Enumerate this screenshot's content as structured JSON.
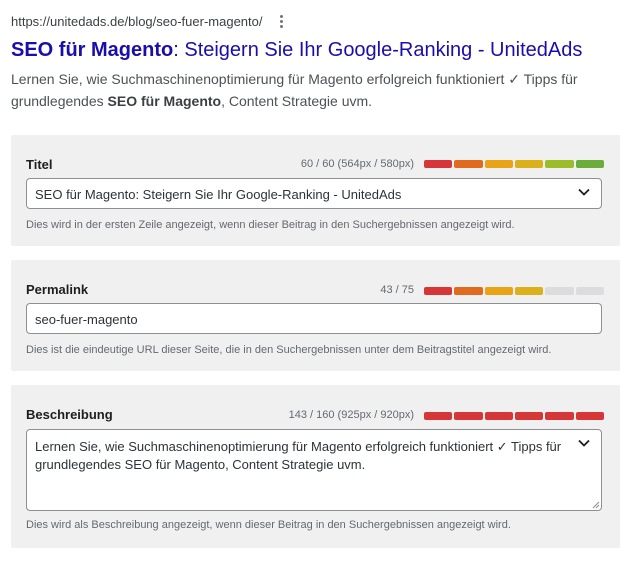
{
  "serp": {
    "url": "https://unitedads.de/blog/seo-fuer-magento/",
    "title_strong": "SEO für Magento",
    "title_rest": ": Steigern Sie Ihr Google-Ranking - UnitedAds",
    "desc_line1": "Lernen Sie, wie Suchmaschinenoptimierung für Magento erfolgreich funktioniert ✓ Tipps für",
    "desc_pre": "grundlegendes ",
    "desc_bold": "SEO für Magento",
    "desc_post": ", Content Strategie uvm."
  },
  "title_card": {
    "label": "Titel",
    "counter": "60 / 60 (564px / 580px)",
    "meter_colors": [
      "#d63638",
      "#e06a20",
      "#e8a317",
      "#dcb01a",
      "#9cbc2a",
      "#6bac3b"
    ],
    "value": "SEO für Magento: Steigern Sie Ihr Google-Ranking - UnitedAds",
    "help": "Dies wird in der ersten Zeile angezeigt, wenn dieser Beitrag in den Suchergebnissen angezeigt wird."
  },
  "permalink_card": {
    "label": "Permalink",
    "counter": "43 / 75",
    "meter_colors": [
      "#d63638",
      "#e06a20",
      "#e8a317",
      "#dcb01a",
      "#dcdcde",
      "#dcdcde"
    ],
    "value": "seo-fuer-magento",
    "help": "Dies ist die eindeutige URL dieser Seite, die in den Suchergebnissen unter dem Beitragstitel angezeigt wird."
  },
  "description_card": {
    "label": "Beschreibung",
    "counter": "143 / 160 (925px / 920px)",
    "meter_colors": [
      "#d63638",
      "#d63638",
      "#d63638",
      "#d63638",
      "#d63638",
      "#d63638"
    ],
    "value": "Lernen Sie, wie Suchmaschinenoptimierung für Magento erfolgreich funktioniert ✓ Tipps für grundlegendes SEO für Magento, Content Strategie uvm.",
    "help": "Dies wird als Beschreibung angezeigt, wenn dieser Beitrag in den Suchergebnissen angezeigt wird."
  }
}
